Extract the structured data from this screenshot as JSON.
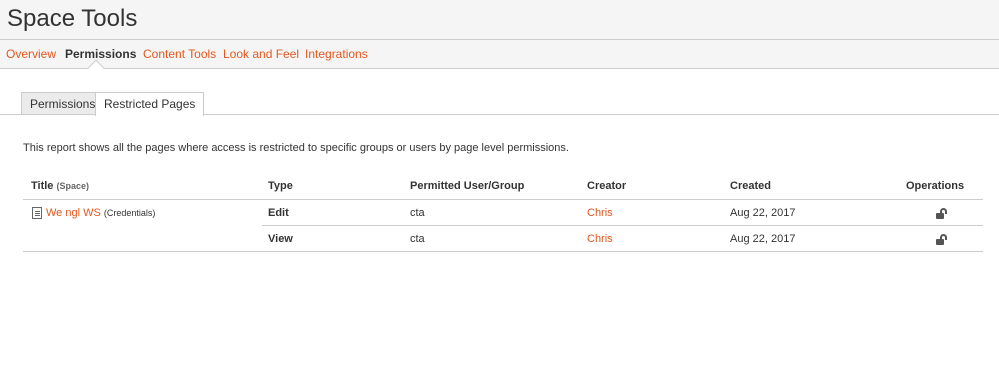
{
  "header": {
    "title": "Space Tools"
  },
  "nav": {
    "tabs": [
      {
        "label": "Overview"
      },
      {
        "label": "Permissions"
      },
      {
        "label": "Content Tools"
      },
      {
        "label": "Look and Feel"
      },
      {
        "label": "Integrations"
      }
    ]
  },
  "subtabs": [
    {
      "label": "Permissions"
    },
    {
      "label": "Restricted Pages"
    }
  ],
  "description": "This report shows all the pages where access is restricted to specific groups or users by page level permissions.",
  "table": {
    "headers": {
      "title": "Title",
      "title_suffix": "(Space)",
      "type": "Type",
      "permitted": "Permitted User/Group",
      "creator": "Creator",
      "created": "Created",
      "operations": "Operations"
    },
    "page": {
      "title": "We  ngl    WS",
      "space": "(Credentials)",
      "icon": "page-icon"
    },
    "rows": [
      {
        "type": "Edit",
        "permitted": "cta",
        "creator": "Chris",
        "created": "Aug 22, 2017",
        "operation_icon": "unlock-icon"
      },
      {
        "type": "View",
        "permitted": "cta",
        "creator": "Chris",
        "created": "Aug 22, 2017",
        "operation_icon": "unlock-icon"
      }
    ]
  },
  "colors": {
    "link": "#e4571e",
    "header_bg": "#f5f5f5",
    "border": "#cccccc"
  }
}
